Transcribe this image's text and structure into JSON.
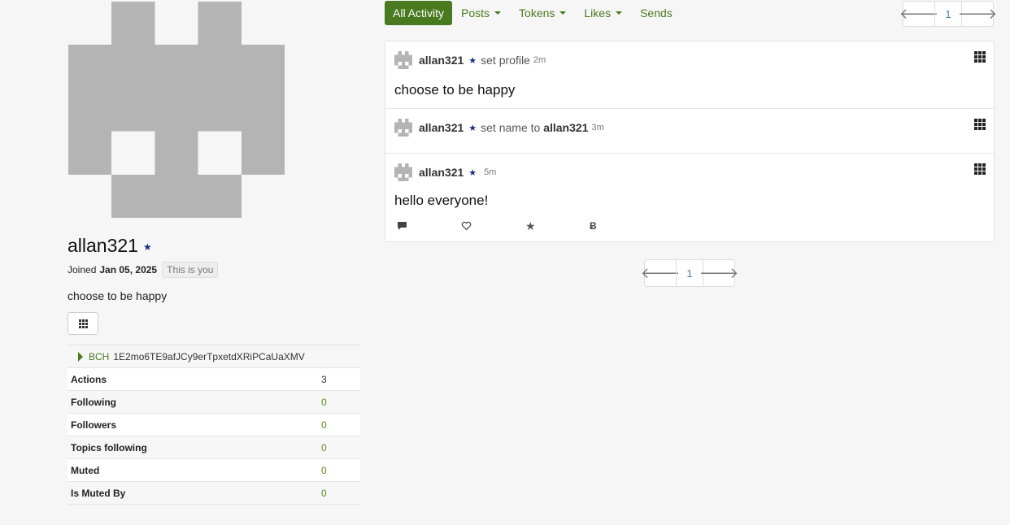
{
  "profile": {
    "name": "allan321",
    "joined_prefix": "Joined",
    "joined_date": "Jan 05, 2025",
    "this_is_you": "This is you",
    "bio": "choose to be happy",
    "wallet": {
      "coin": "BCH",
      "address": "1E2mo6TE9afJCy9erTpxetdXRiPCaUaXMV"
    },
    "stats": [
      {
        "label": "Actions",
        "value": "3"
      },
      {
        "label": "Following",
        "value": "0"
      },
      {
        "label": "Followers",
        "value": "0"
      },
      {
        "label": "Topics following",
        "value": "0"
      },
      {
        "label": "Muted",
        "value": "0"
      },
      {
        "label": "Is Muted By",
        "value": "0"
      }
    ]
  },
  "nav": {
    "tabs": [
      {
        "label": "All Activity",
        "active": true
      },
      {
        "label": "Posts",
        "dropdown": true
      },
      {
        "label": "Tokens",
        "dropdown": true
      },
      {
        "label": "Likes",
        "dropdown": true
      },
      {
        "label": "Sends"
      }
    ]
  },
  "pagination": {
    "page": "1"
  },
  "feed": [
    {
      "user": "allan321",
      "action": "set profile",
      "time": "2m",
      "body": "choose to be happy"
    },
    {
      "user": "allan321",
      "action_prefix": "set name to",
      "action_target": "allan321",
      "time": "3m"
    },
    {
      "user": "allan321",
      "time": "5m",
      "body": "hello everyone!",
      "actions": [
        "comment-icon",
        "heart-icon",
        "star-icon",
        "bitcoin-icon"
      ]
    }
  ],
  "colors": {
    "accent": "#4a7a1f",
    "star": "#1a2a8a",
    "avatar": "#b4b4b4"
  }
}
